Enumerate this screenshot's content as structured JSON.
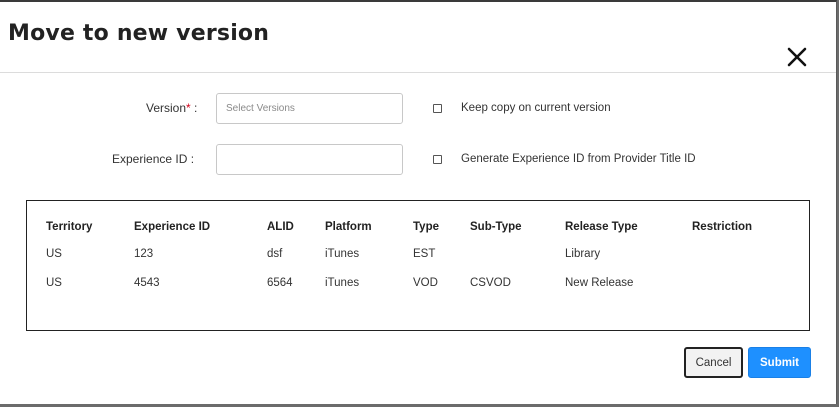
{
  "dialog": {
    "title": "Move to new version",
    "close_icon": "close-icon"
  },
  "form": {
    "version": {
      "label": "Version",
      "required_mark": "*",
      "colon": " :",
      "placeholder": "Select Versions",
      "value": ""
    },
    "experience_id": {
      "label": "Experience ID :",
      "value": ""
    },
    "keep_copy": {
      "label": "Keep copy on current version",
      "checked": false
    },
    "generate_id": {
      "label": "Generate Experience ID from Provider Title ID",
      "checked": false
    }
  },
  "table": {
    "columns": [
      "Territory",
      "Experience ID",
      "ALID",
      "Platform",
      "Type",
      "Sub-Type",
      "Release Type",
      "Restriction"
    ],
    "rows": [
      [
        "US",
        "123",
        "dsf",
        "iTunes",
        "EST",
        "",
        "Library",
        ""
      ],
      [
        "US",
        "4543",
        "6564",
        "iTunes",
        "VOD",
        "CSVOD",
        "New Release",
        ""
      ]
    ]
  },
  "buttons": {
    "cancel": "Cancel",
    "submit": "Submit"
  },
  "colors": {
    "accent": "#1e90ff",
    "required": "#d0021b"
  }
}
